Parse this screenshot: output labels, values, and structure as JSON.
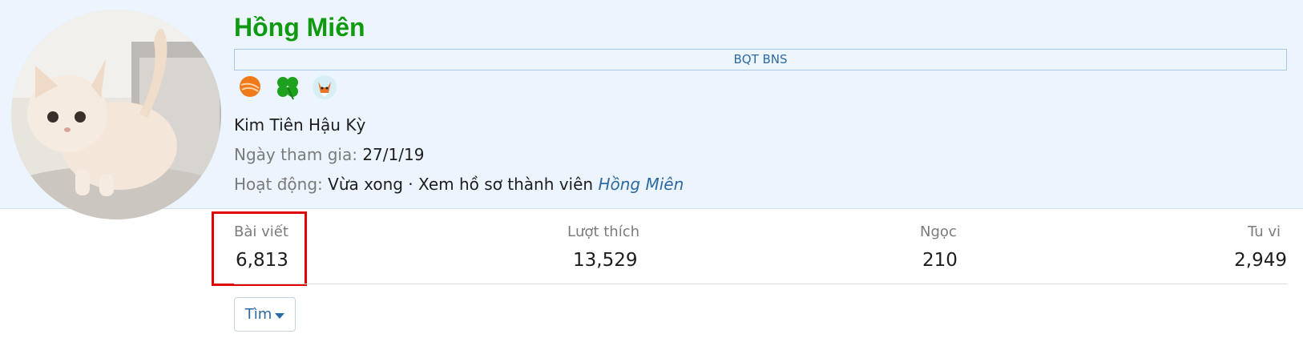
{
  "profile": {
    "username": "Hồng Miên",
    "banner": "BQT BNS",
    "trophies": [
      {
        "icon": "orange-ball-icon"
      },
      {
        "icon": "clover-icon"
      },
      {
        "icon": "fox-icon"
      }
    ],
    "rank": "Kim Tiên Hậu Kỳ",
    "joined_label": "Ngày tham gia:",
    "joined_value": "27/1/19",
    "activity_label": "Hoạt động:",
    "activity_text": "Vừa xong · Xem hồ sơ thành viên",
    "activity_link": "Hồng Miên"
  },
  "stats": {
    "posts": {
      "label": "Bài viết",
      "value": "6,813"
    },
    "likes": {
      "label": "Lượt thích",
      "value": "13,529"
    },
    "gems": {
      "label": "Ngọc",
      "value": "210"
    },
    "cultivation": {
      "label": "Tu vi",
      "value": "2,949"
    }
  },
  "actions": {
    "find_label": "Tìm"
  },
  "colors": {
    "username": "#109a10",
    "link": "#2d6aa3",
    "highlight": "#e00000",
    "header_bg": "#ecf4fd"
  }
}
